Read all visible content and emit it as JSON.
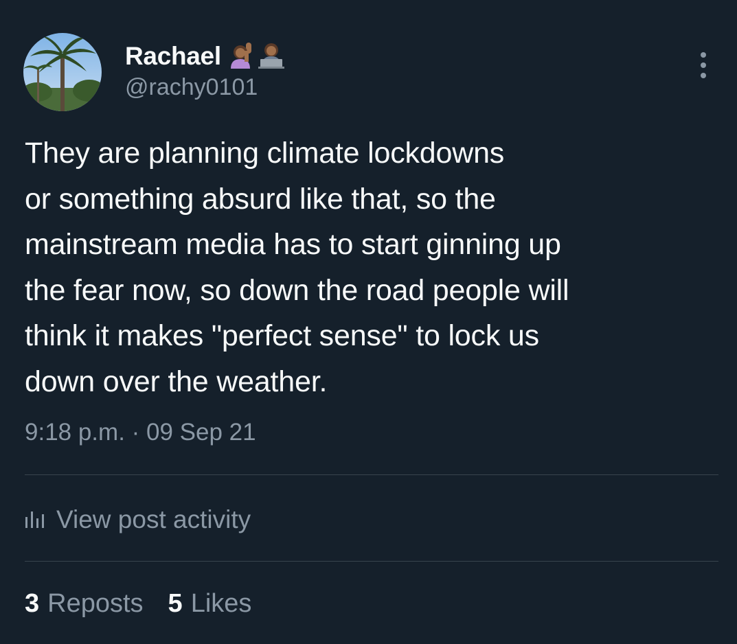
{
  "colors": {
    "background": "#15202b",
    "primary_text": "#f7f9f9",
    "secondary_text": "#8b98a5",
    "divider": "#38444d"
  },
  "author": {
    "display_name": "Rachael",
    "handle": "@rachy0101",
    "avatar_icon": "palm-tree-avatar",
    "name_emojis": [
      "woman-raising-hand-emoji",
      "woman-technologist-emoji"
    ]
  },
  "menu_icon": "more-dots-icon",
  "tweet": {
    "text": "They are planning climate lockdowns\nor something absurd like that, so the\nmainstream media has to start ginning up\nthe fear now, so down the road people will\nthink it makes \"perfect sense\" to lock us\ndown over the weather.",
    "timestamp": "9:18 p.m. · 09 Sep 21"
  },
  "activity": {
    "icon": "analytics-bar-icon",
    "label": "View post activity"
  },
  "stats": {
    "reposts_count": "3",
    "reposts_label": "Reposts",
    "likes_count": "5",
    "likes_label": "Likes"
  }
}
